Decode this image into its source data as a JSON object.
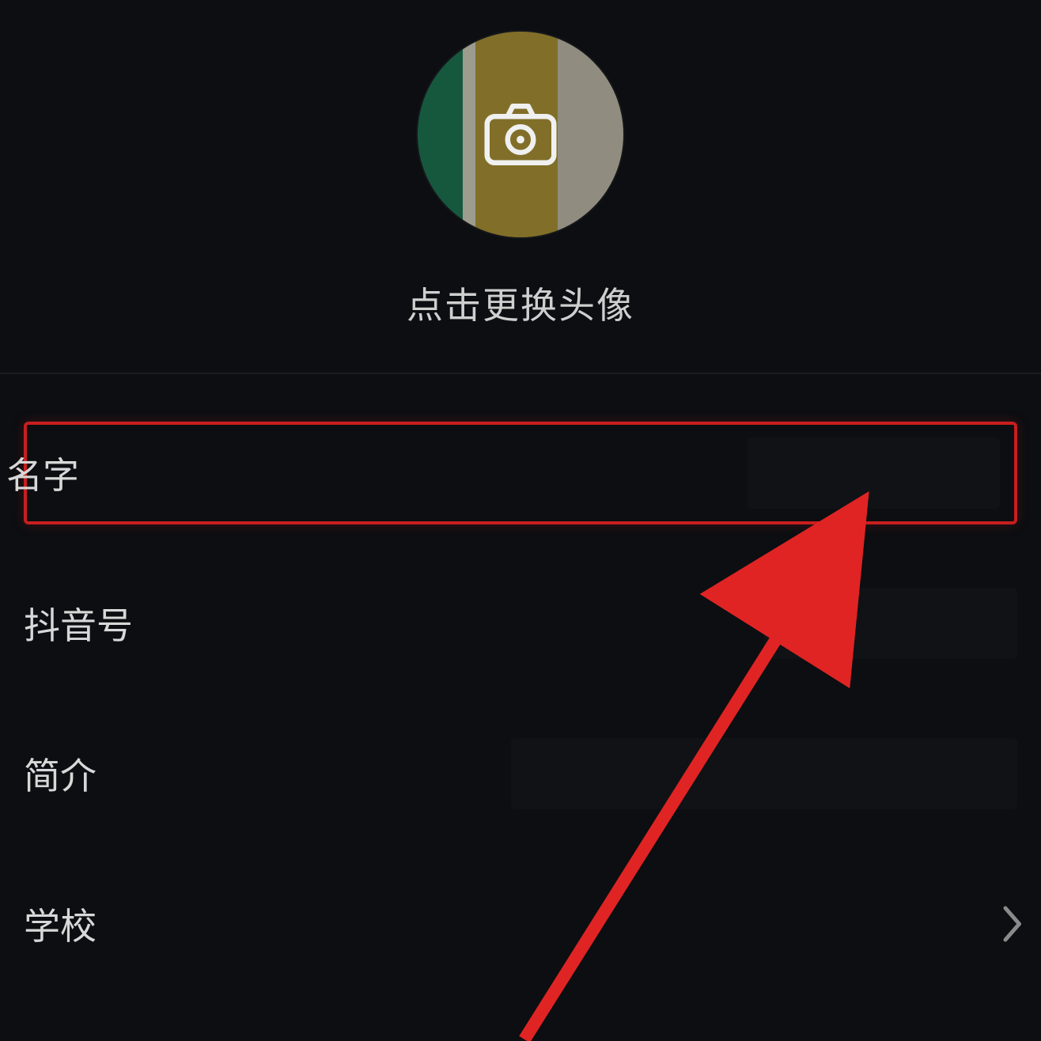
{
  "avatar": {
    "hint": "点击更换头像",
    "camera_icon_name": "camera-icon"
  },
  "rows": {
    "name": {
      "label": "名字"
    },
    "douyin_id": {
      "label": "抖音号"
    },
    "bio": {
      "label": "简介"
    },
    "school": {
      "label": "学校"
    }
  },
  "colors": {
    "highlight": "#c81e1e",
    "bg": "#0c0e11",
    "text": "#d8d8d8"
  }
}
